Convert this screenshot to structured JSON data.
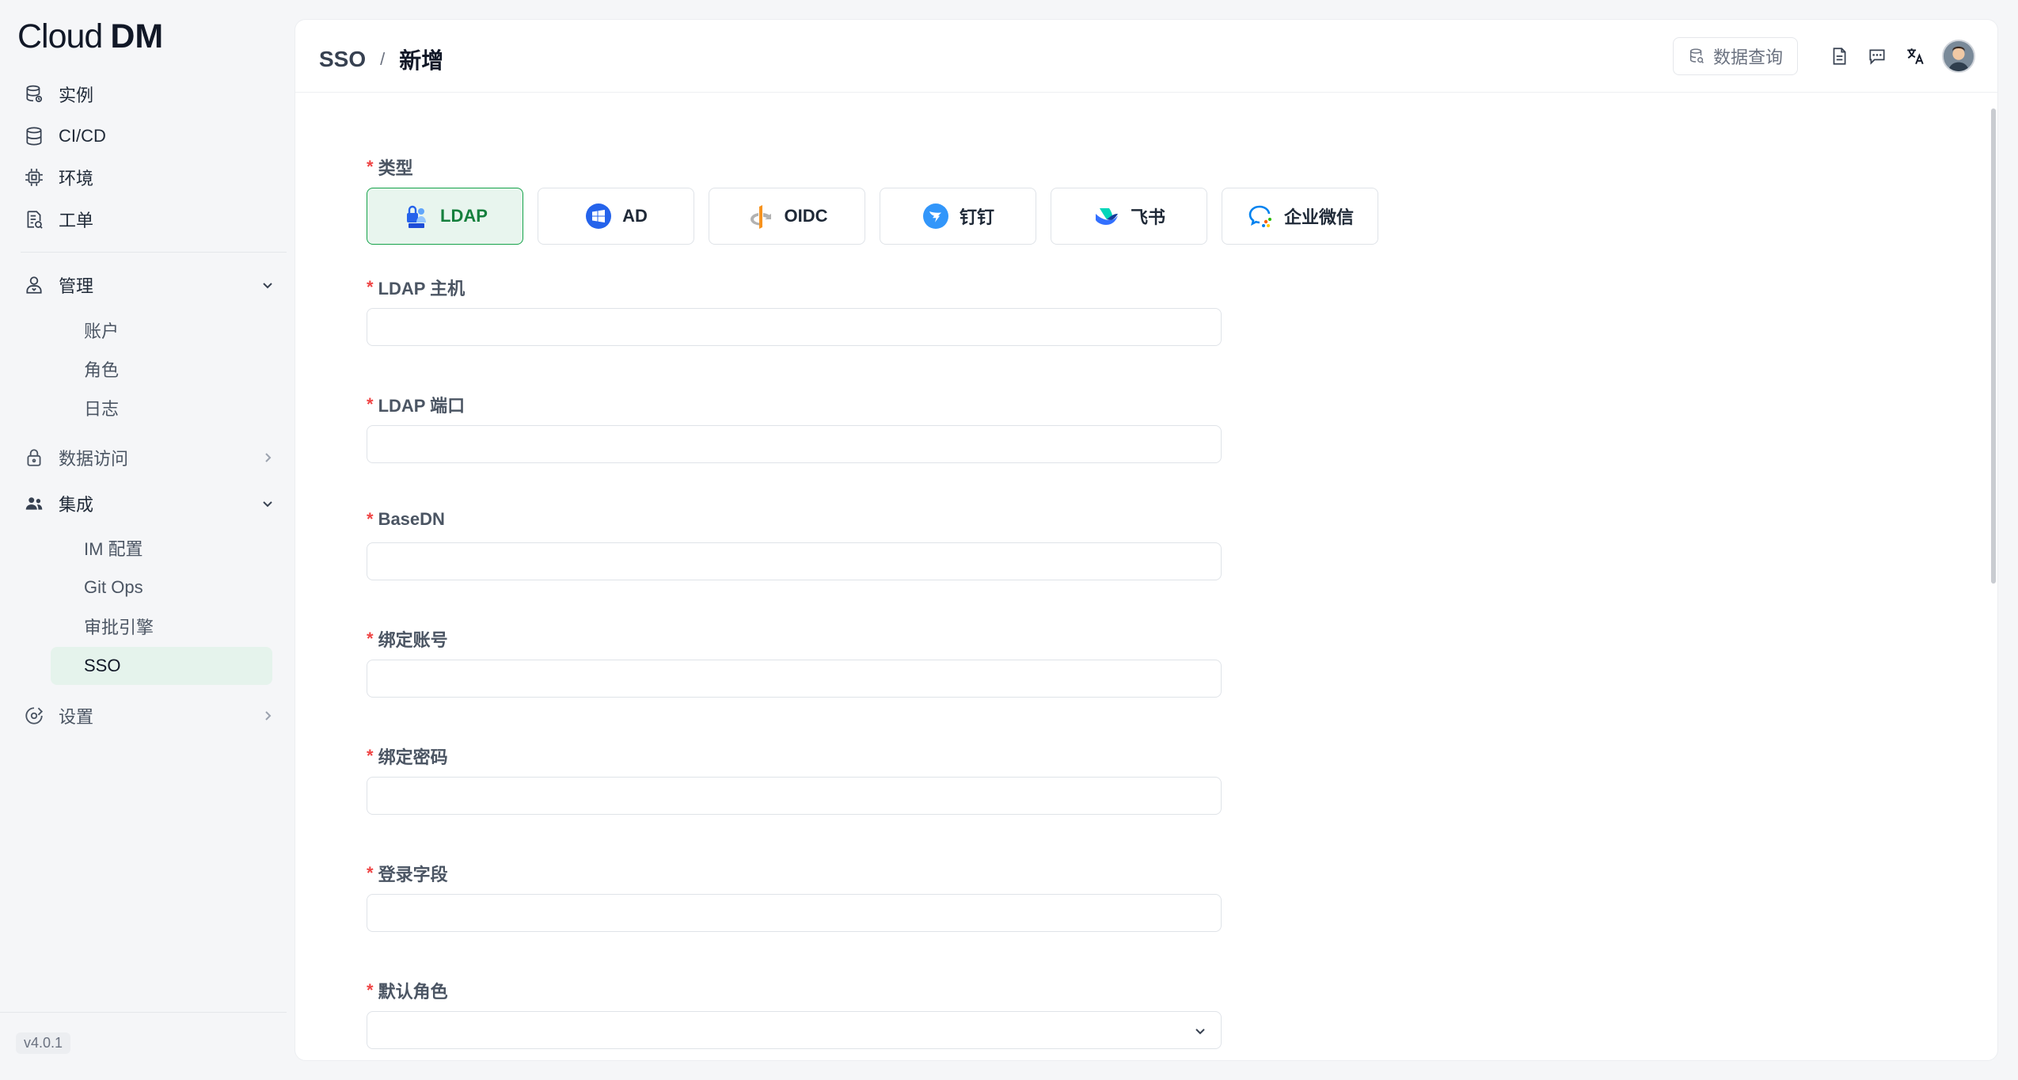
{
  "app": {
    "logo_main": "Cloud",
    "logo_bold": "DM",
    "version": "v4.0.1"
  },
  "sidebar": {
    "top_items": [
      {
        "label": "实例",
        "icon": "database-icon"
      },
      {
        "label": "CI/CD",
        "icon": "stack-icon"
      },
      {
        "label": "环境",
        "icon": "chip-icon"
      },
      {
        "label": "工单",
        "icon": "ticket-icon"
      }
    ],
    "admin": {
      "label": "管理",
      "icon": "user-admin-icon",
      "children": [
        "账户",
        "角色",
        "日志"
      ]
    },
    "data_access": {
      "label": "数据访问",
      "icon": "lock-icon"
    },
    "integration": {
      "label": "集成",
      "icon": "users-icon",
      "children": [
        "IM 配置",
        "Git Ops",
        "审批引擎",
        "SSO"
      ]
    },
    "settings": {
      "label": "设置",
      "icon": "settings-icon"
    }
  },
  "header": {
    "breadcrumb": [
      "SSO",
      "新增"
    ],
    "separator": "/",
    "query_button": "数据查询"
  },
  "form": {
    "type_label": "类型",
    "types": [
      {
        "label": "LDAP",
        "active": true
      },
      {
        "label": "AD",
        "active": false
      },
      {
        "label": "OIDC",
        "active": false
      },
      {
        "label": "钉钉",
        "active": false
      },
      {
        "label": "飞书",
        "active": false
      },
      {
        "label": "企业微信",
        "active": false
      }
    ],
    "fields": [
      {
        "label": "LDAP 主机",
        "value": ""
      },
      {
        "label": "LDAP 端口",
        "value": ""
      },
      {
        "label": "BaseDN",
        "value": ""
      },
      {
        "label": "绑定账号",
        "value": ""
      },
      {
        "label": "绑定密码",
        "value": ""
      },
      {
        "label": "登录字段",
        "value": ""
      },
      {
        "label": "默认角色",
        "value": ""
      }
    ],
    "required_mark": "*"
  },
  "colors": {
    "accent": "#16a34a",
    "active_bg": "#e8f5ee",
    "required": "#ef4444"
  }
}
